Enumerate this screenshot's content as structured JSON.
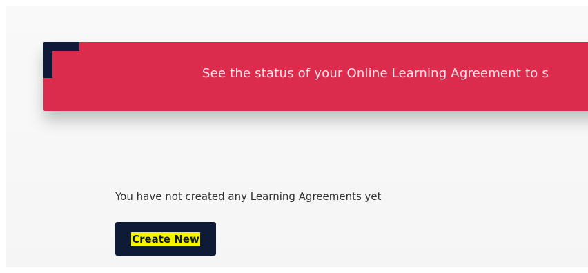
{
  "banner": {
    "text": "See the status of your Online Learning Agreement to s"
  },
  "empty_state": {
    "message": "You have not created any Learning Agreements yet"
  },
  "actions": {
    "create_new_label": "Create New"
  },
  "colors": {
    "banner_background": "#dc2c4e",
    "corner_accent": "#0f1a3a",
    "button_background": "#0f1a36",
    "button_label_highlight": "#f5f500"
  }
}
